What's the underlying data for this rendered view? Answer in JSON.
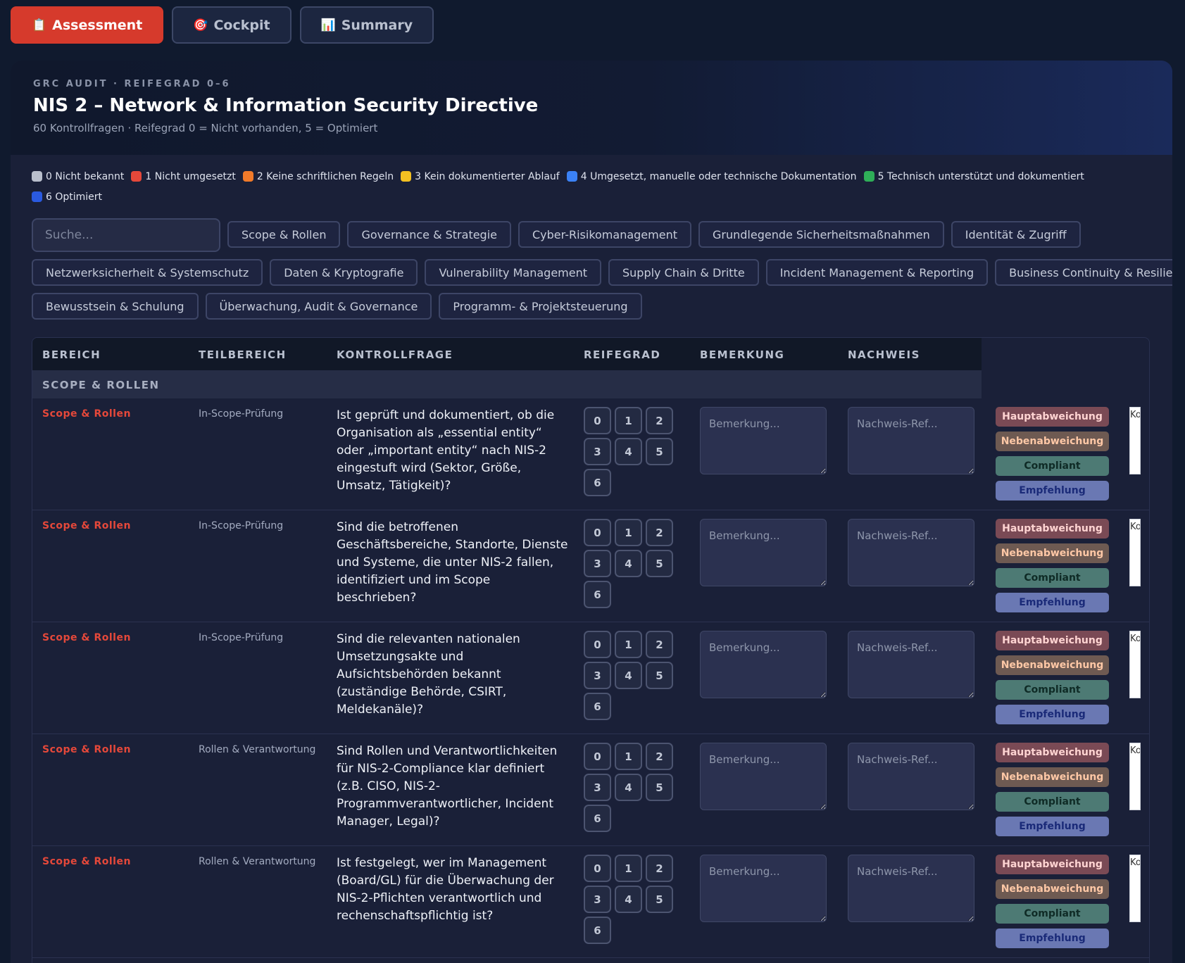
{
  "tabs": [
    {
      "icon": "📋",
      "label": "Assessment"
    },
    {
      "icon": "🎯",
      "label": "Cockpit"
    },
    {
      "icon": "📊",
      "label": "Summary"
    }
  ],
  "header": {
    "eyebrow": "GRC AUDIT · REIFEGRAD 0–6",
    "title": "NIS 2 – Network & Information Security Directive",
    "subtitle": "60 Kontrollfragen · Reifegrad 0 = Nicht vorhanden, 5 = Optimiert"
  },
  "legend": [
    {
      "label": "0 Nicht bekannt",
      "color": "#b9bfcc"
    },
    {
      "label": "1 Nicht umgesetzt",
      "color": "#e5483a"
    },
    {
      "label": "2 Keine schriftlichen Regeln",
      "color": "#f07a2a"
    },
    {
      "label": "3 Kein dokumentierter Ablauf",
      "color": "#f2c022"
    },
    {
      "label": "4 Umgesetzt, manuelle oder technische Dokumentation",
      "color": "#3b82f6"
    },
    {
      "label": "5 Technisch unterstützt und dokumentiert",
      "color": "#2fae58"
    },
    {
      "label": "6 Optimiert",
      "color": "#2a5ae0"
    }
  ],
  "search": {
    "placeholder": "Suche..."
  },
  "filters": [
    "Scope & Rollen",
    "Governance & Strategie",
    "Cyber-Risikomanagement",
    "Grundlegende Sicherheitsmaßnahmen",
    "Identität & Zugriff",
    "Netzwerksicherheit & Systemschutz",
    "Daten & Kryptografie",
    "Vulnerability Management",
    "Supply Chain & Dritte",
    "Incident Management & Reporting",
    "Business Continuity & Resilienz",
    "Bewusstsein & Schulung",
    "Überwachung, Audit & Governance",
    "Programm- & Projektsteuerung"
  ],
  "table": {
    "columns": [
      "BEREICH",
      "TEILBEREICH",
      "KONTROLLFRAGE",
      "REIFEGRAD",
      "BEMERKUNG",
      "NACHWEIS"
    ],
    "section": "SCOPE & ROLLEN",
    "scale": [
      "0",
      "1",
      "2",
      "3",
      "4",
      "5",
      "6"
    ],
    "remark_placeholder": "Bemerkung...",
    "evidence_placeholder": "Nachweis-Ref...",
    "tags": [
      "Hauptabweichung",
      "Nebenabweichung",
      "Compliant",
      "Empfehlung"
    ],
    "rows": [
      {
        "bereich": "Scope & Rollen",
        "teil": "In-Scope-Prüfung",
        "frage": "Ist geprüft und dokumentiert, ob die Organisation als „essential entity“ oder „important entity“ nach NIS-2 eingestuft wird (Sektor, Größe, Umsatz, Tätigkeit)?"
      },
      {
        "bereich": "Scope & Rollen",
        "teil": "In-Scope-Prüfung",
        "frage": "Sind die betroffenen Geschäftsbereiche, Standorte, Dienste und Systeme, die unter NIS-2 fallen, identifiziert und im Scope beschrieben?"
      },
      {
        "bereich": "Scope & Rollen",
        "teil": "In-Scope-Prüfung",
        "frage": "Sind die relevanten nationalen Umsetzungsakte und Aufsichtsbehörden bekannt (zuständige Behörde, CSIRT, Meldekanäle)?"
      },
      {
        "bereich": "Scope & Rollen",
        "teil": "Rollen & Verantwortung",
        "frage": "Sind Rollen und Verantwortlichkeiten für NIS-2-Compliance klar definiert (z.B. CISO, NIS-2-Programmverantwortlicher, Incident Manager, Legal)?"
      },
      {
        "bereich": "Scope & Rollen",
        "teil": "Rollen & Verantwortung",
        "frage": "Ist festgelegt, wer im Management (Board/GL) für die Überwachung der NIS-2-Pflichten verantwortlich und rechenschaftspflichtig ist?"
      }
    ],
    "kbox_text": "Kom"
  }
}
